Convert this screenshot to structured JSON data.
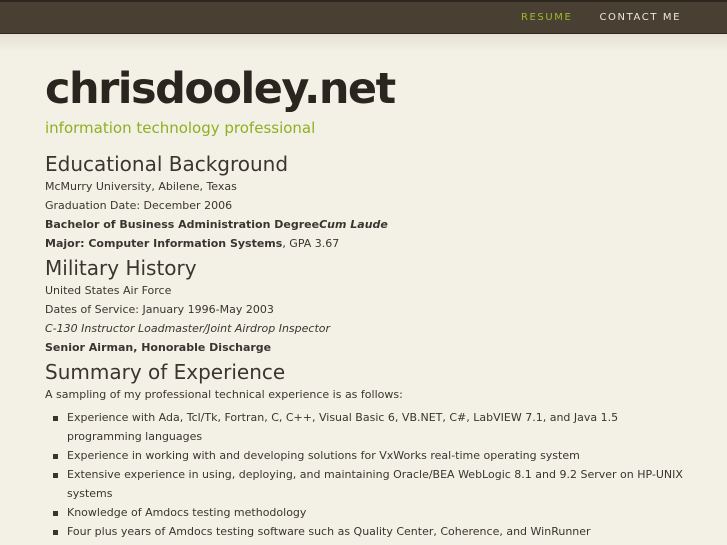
{
  "nav": {
    "resume": "RESUME",
    "contact": "CONTACT ME"
  },
  "header": {
    "title": "chrisdooley.net",
    "tagline": "information technology professional"
  },
  "education": {
    "heading": "Educational Background",
    "school": "McMurry University, Abilene, Texas",
    "graduation": "Graduation Date: December 2006",
    "degree": "Bachelor of Business Administration Degree",
    "honors": "Cum Laude",
    "major_label": "Major: Computer Information Systems",
    "gpa": ", GPA 3.67"
  },
  "military": {
    "heading": "Military History",
    "branch": "United States Air Force",
    "dates": "Dates of Service: January 1996-May 2003",
    "role": "C-130 Instructor Loadmaster/Joint Airdrop Inspector",
    "discharge": "Senior Airman, Honorable Discharge"
  },
  "experience": {
    "heading": "Summary of Experience",
    "intro": "A sampling of my professional technical experience is as follows:",
    "items": [
      "Experience with Ada, Tcl/Tk, Fortran, C, C++, Visual Basic 6, VB.NET, C#, LabVIEW 7.1, and Java 1.5 programming languages",
      "Experience in working with and developing solutions for VxWorks real-time operating system",
      "Extensive experience in using, deploying, and maintaining Oracle/BEA WebLogic 8.1 and 9.2 Server on HP-UNIX systems",
      "Knowledge of Amdocs testing methodology",
      "Four plus years of Amdocs testing software such as Quality Center, Coherence, and WinRunner"
    ]
  },
  "colors": {
    "topbar": "#4a3f33",
    "background": "#f3f0e5",
    "accent_green": "#8fb021",
    "text": "#3a3530"
  }
}
